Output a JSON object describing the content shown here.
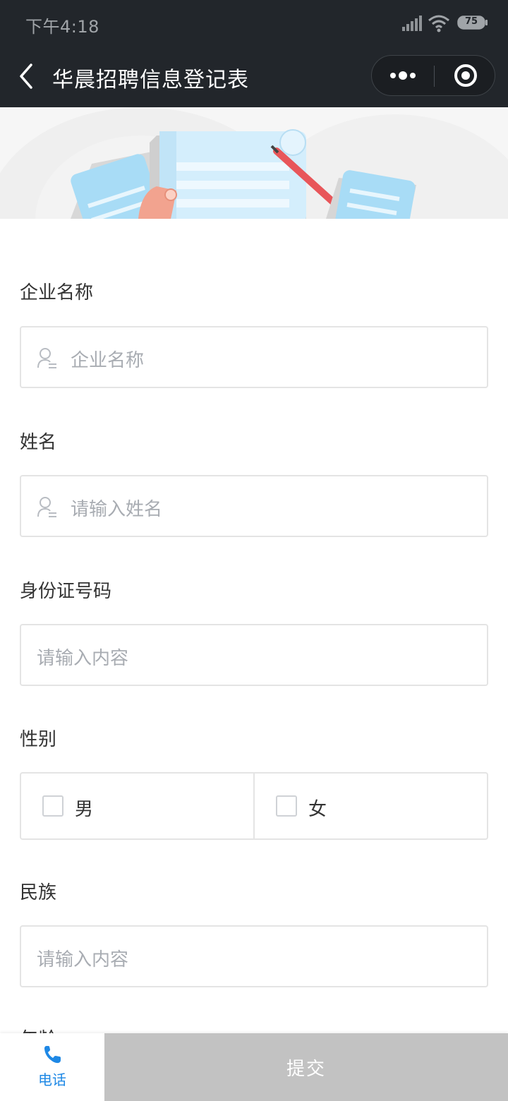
{
  "status_bar": {
    "time": "下午4:18",
    "battery": "75"
  },
  "nav": {
    "title": "华晨招聘信息登记表",
    "back_icon": "chevron-left-icon",
    "more_icon": "more-dots-icon",
    "close_icon": "target-close-icon"
  },
  "form": {
    "company": {
      "label": "企业名称",
      "placeholder": "企业名称",
      "icon": "user-icon"
    },
    "name": {
      "label": "姓名",
      "placeholder": "请输入姓名",
      "icon": "user-icon"
    },
    "id_number": {
      "label": "身份证号码",
      "placeholder": "请输入内容"
    },
    "gender": {
      "label": "性别",
      "options": [
        "男",
        "女"
      ]
    },
    "ethnicity": {
      "label": "民族",
      "placeholder": "请输入内容"
    },
    "age": {
      "label": "年龄"
    }
  },
  "bottom_bar": {
    "phone_label": "电话",
    "phone_icon": "phone-icon",
    "submit_label": "提交"
  },
  "colors": {
    "header_bg": "#22262b",
    "accent_blue": "#1e88e5",
    "submit_disabled": "#c2c2c2",
    "border": "#e4e4e4"
  }
}
